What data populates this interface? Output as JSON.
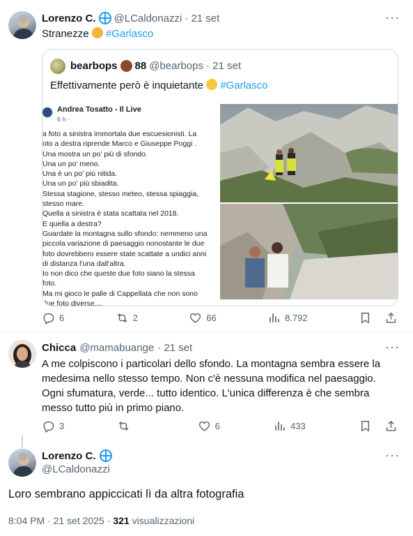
{
  "tweet1": {
    "author_name": "Lorenzo C.",
    "handle": "@LCaldonazzi",
    "date": "· 21 set",
    "text": "Stranezze",
    "hashtag": "#Garlasco",
    "quote": {
      "author_name": "bearbops",
      "author_suffix": "88",
      "handle": "@bearbops",
      "date": "· 21 set",
      "text": "Effettivamente però è inquietante",
      "hashtag": "#Garlasco",
      "embedded_post": {
        "page_name": "Andrea Tosatto - Il Live",
        "meta": "6 h ·",
        "lines": [
          "a foto a sinistra immortala due escuesionisti. La",
          "oto a destra riprende Marco e Giuseppe Poggi .",
          "Una mostra un po' più di sfondo.",
          "Una un po' meno.",
          "Una è un po' più nitida.",
          "Una un po' più sbiadita.",
          "Stessa stagione, stesso meteo, stessa spiaggia,",
          "stesso mare.",
          "Quella a sinistra è stata scattata nel 2018.",
          "E quella a destra?",
          "Guardate la montagna sullo sfondo: nemmeno una",
          "piccola variazione di paesaggio nonostante le due",
          "foto dovrebbero essere state scattate a undici anni",
          "di distanza l'una dall'altra.",
          "Io non dico che queste due foto siano la stessa",
          "foto.",
          "Ma mi gioco le palle di Cappellata che non sono",
          "due foto diverse...."
        ]
      }
    },
    "stats": {
      "replies": "6",
      "reposts": "2",
      "likes": "66",
      "views": "8.792"
    }
  },
  "tweet2": {
    "author_name": "Chicca",
    "handle": "@mamabuange",
    "date": "· 21 set",
    "lines": [
      "A me colpiscono i particolari dello sfondo. La montagna sembra essere la",
      "medesima nello stesso tempo. Non c'è nessuna modifica nel paesaggio.",
      "Ogni sfumatura, verde... tutto identico. L'unica differenza è che sembra",
      "messo tutto più in primo piano."
    ],
    "stats": {
      "replies": "3",
      "reposts": "",
      "likes": "6",
      "views": "433"
    }
  },
  "tweet3": {
    "author_name": "Lorenzo C.",
    "handle": "@LCaldonazzi",
    "text": "Loro sembrano appiccicati lì da altra fotografia",
    "timestamp": "8:04 PM · 21 set 2025 ·",
    "views_count": "321",
    "views_label": "visualizzazioni"
  },
  "icons": {
    "more": "more-icon",
    "verified": "verified-badge-icon",
    "reply": "reply-icon",
    "repost": "repost-icon",
    "like": "like-icon",
    "views": "views-icon",
    "bookmark": "bookmark-icon",
    "share": "share-icon"
  },
  "colors": {
    "link": "#1d9bf0",
    "muted": "#536471",
    "text": "#0f1419",
    "border": "#cfd9de"
  }
}
